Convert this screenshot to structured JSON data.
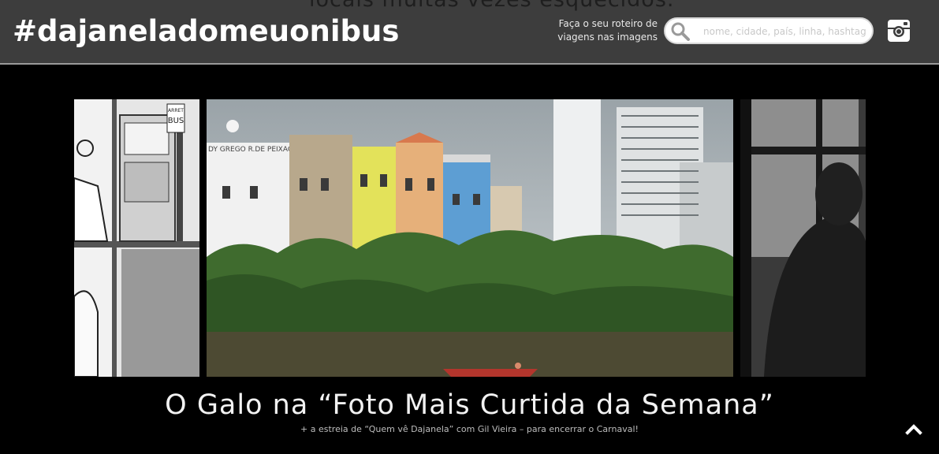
{
  "header": {
    "ghost_text": "locais muitas vezes esquecidos.",
    "logo": "#dajaneladomeuonibus",
    "tagline": "Faça o seu roteiro de viagens nas imagens",
    "search_placeholder": "nome, cidade, país, linha, hashtag",
    "search_icon": "magnifier-icon",
    "instagram_icon": "instagram-icon"
  },
  "carousel": {
    "left_sign_top": "ARRET",
    "left_sign_bottom": "BUS",
    "main_building_sign": "DY GREGO R.DE PEIXACHO"
  },
  "post": {
    "title": "O Galo na “Foto Mais Curtida da Semana”",
    "subtitle": "+ a estreia de “Quem vê Dajanela” com Gil Vieira – para encerrar o Carnaval!"
  },
  "colors": {
    "header_bg": "#3d3d3d",
    "page_bg": "#000000"
  },
  "scroll_top_icon": "chevron-up-icon"
}
